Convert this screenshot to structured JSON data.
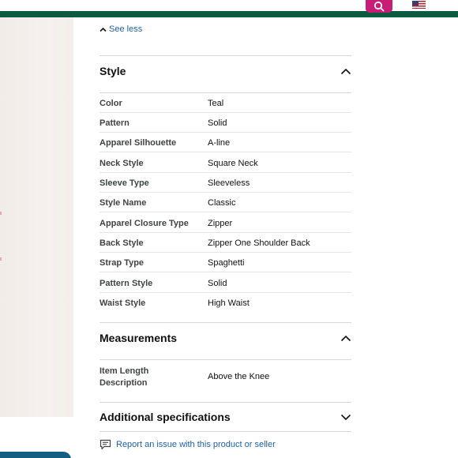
{
  "header": {
    "language_label": "EN",
    "colors": {
      "strip": "#0b5a41",
      "search_button": "#c81d77"
    }
  },
  "details": {
    "see_less_label": "See less",
    "style": {
      "title": "Style",
      "rows": [
        {
          "name": "Color",
          "value": "Teal"
        },
        {
          "name": "Pattern",
          "value": "Solid"
        },
        {
          "name": "Apparel Silhouette",
          "value": "A-line"
        },
        {
          "name": "Neck Style",
          "value": "Square Neck"
        },
        {
          "name": "Sleeve Type",
          "value": "Sleeveless"
        },
        {
          "name": "Style Name",
          "value": "Classic"
        },
        {
          "name": "Apparel Closure Type",
          "value": "Zipper"
        },
        {
          "name": "Back Style",
          "value": "Zipper One Shoulder Back"
        },
        {
          "name": "Strap Type",
          "value": "Spaghetti"
        },
        {
          "name": "Pattern Style",
          "value": "Solid"
        },
        {
          "name": "Waist Style",
          "value": "High Waist"
        }
      ]
    },
    "measurements": {
      "title": "Measurements",
      "rows": [
        {
          "name": "Item Length Description",
          "value": "Above the Knee"
        }
      ]
    },
    "additional": {
      "title": "Additional specifications"
    },
    "report_label": "Report an issue with this product or seller"
  }
}
